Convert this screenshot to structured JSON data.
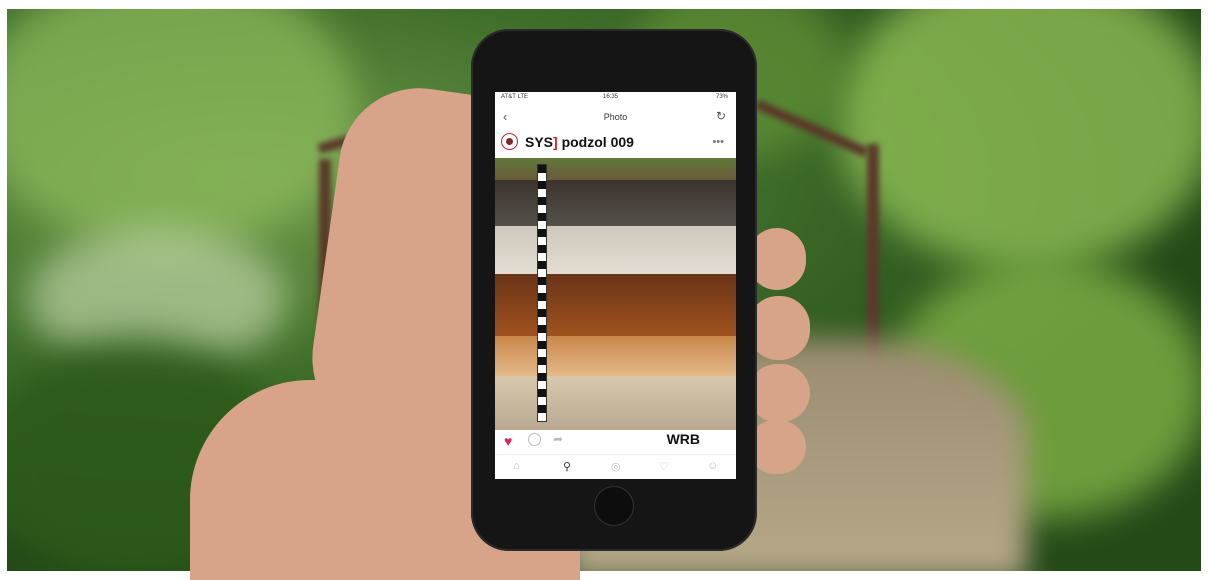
{
  "phone": {
    "status_bar": {
      "carrier": "AT&T LTE",
      "time": "16:35",
      "battery": "73%"
    },
    "nav": {
      "title": "Photo"
    },
    "post": {
      "brand": "SYS",
      "brand_bar": "]",
      "account_name": "podzol 009",
      "caption": "WRB"
    }
  },
  "icons": [
    "back-arrow-icon",
    "refresh-icon",
    "more-icon",
    "heart-icon",
    "comment-icon",
    "share-icon",
    "home-icon",
    "search-icon",
    "camera-icon",
    "activity-icon",
    "profile-icon"
  ],
  "colors": {
    "brand_red": "#d0202a",
    "heart": "#e0245e",
    "forest": "#3f6e2a"
  }
}
